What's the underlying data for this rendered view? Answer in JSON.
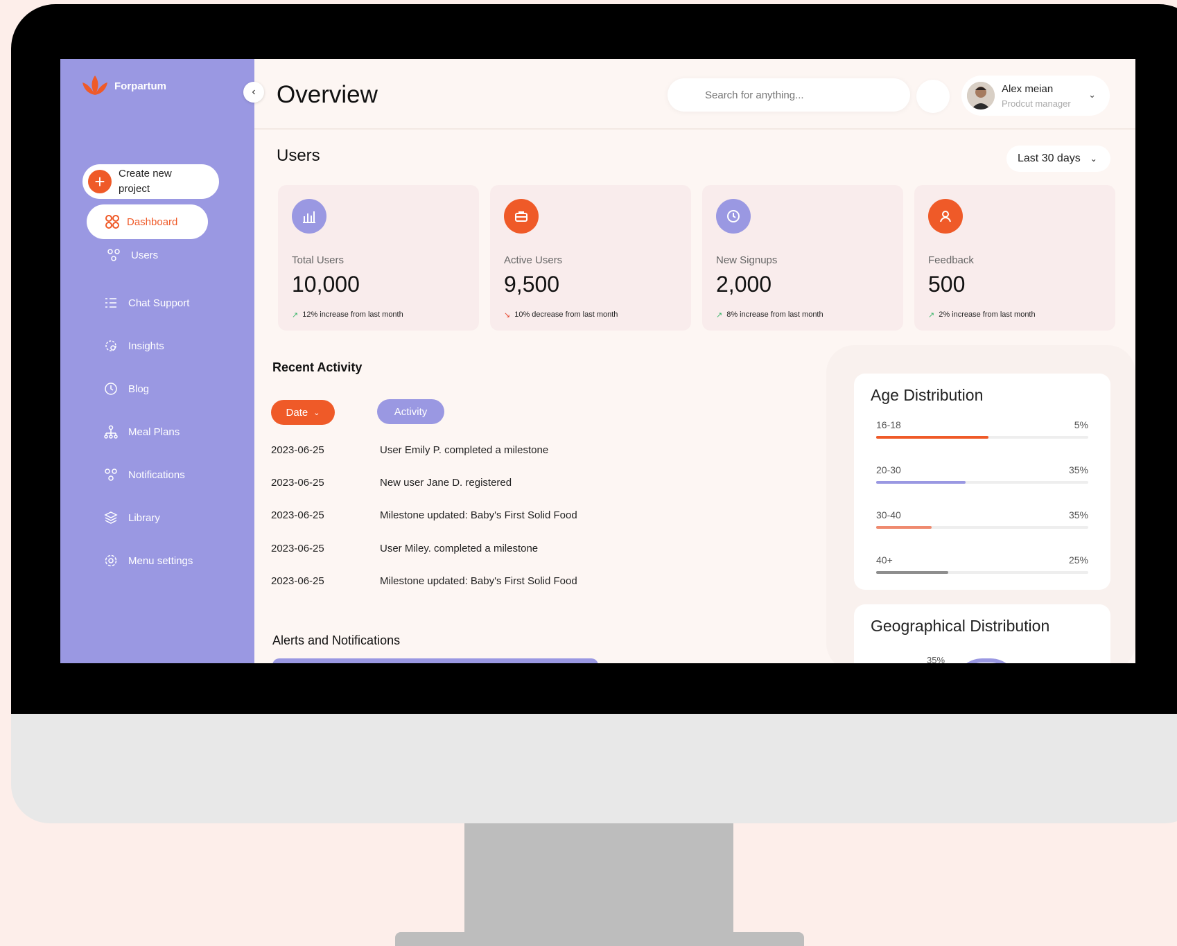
{
  "app": {
    "logo_text": "Forpartum",
    "page_title": "Overview"
  },
  "sidebar": {
    "create_label": "Create new project",
    "dashboard_label": "Dashboard",
    "items": [
      {
        "label": "Users",
        "icon": "users-icon"
      },
      {
        "label": "Chat Support",
        "icon": "list-icon"
      },
      {
        "label": "Insights",
        "icon": "insights-icon"
      },
      {
        "label": "Blog",
        "icon": "clock-icon"
      },
      {
        "label": "Meal Plans",
        "icon": "hierarchy-icon"
      },
      {
        "label": "Notifications",
        "icon": "people-icon"
      },
      {
        "label": "Library",
        "icon": "layers-icon"
      },
      {
        "label": "Menu settings",
        "icon": "gear-icon"
      }
    ]
  },
  "header": {
    "search_placeholder": "Search for anything...",
    "user_name": "Alex meian",
    "user_role": "Prodcut manager"
  },
  "users": {
    "title": "Users",
    "range": "Last 30 days",
    "cards": [
      {
        "label": "Total Users",
        "value": "10,000",
        "trend": "12% increase from last month",
        "direction": "up",
        "icon": "bar-chart-icon",
        "color": "#9a98e2"
      },
      {
        "label": "Active Users",
        "value": "9,500",
        "trend": "10% decrease from last month",
        "direction": "down",
        "icon": "briefcase-icon",
        "color": "#ef5a28"
      },
      {
        "label": "New Signups",
        "value": "2,000",
        "trend": "8% increase from last month",
        "direction": "up",
        "icon": "clock-icon",
        "color": "#9a98e2"
      },
      {
        "label": "Feedback",
        "value": "500",
        "trend": "2% increase from last month",
        "direction": "up",
        "icon": "user-icon",
        "color": "#ef5a28"
      }
    ]
  },
  "recent_activity": {
    "title": "Recent Activity",
    "filter_date": "Date",
    "filter_activity": "Activity",
    "rows": [
      {
        "date": "2023-06-25",
        "activity": "User Emily P. completed a milestone"
      },
      {
        "date": "2023-06-25",
        "activity": "New user Jane D. registered"
      },
      {
        "date": "2023-06-25",
        "activity": "Milestone updated: Baby's First Solid Food"
      },
      {
        "date": "2023-06-25",
        "activity": "User Miley. completed a milestone"
      },
      {
        "date": "2023-06-25",
        "activity": "Milestone updated: Baby's First Solid Food"
      }
    ]
  },
  "alerts": {
    "title": "Alerts and Notifications"
  },
  "age_distribution": {
    "title": "Age Distribution",
    "rows": [
      {
        "label": "16-18",
        "percent": "5%",
        "fill": 0.53,
        "color": "#ef5a28"
      },
      {
        "label": "20-30",
        "percent": "35%",
        "fill": 0.42,
        "color": "#9a98e2"
      },
      {
        "label": "30-40",
        "percent": "35%",
        "fill": 0.26,
        "color": "#ef8a6f"
      },
      {
        "label": "40+",
        "percent": "25%",
        "fill": 0.34,
        "color": "#8e8e8e"
      }
    ]
  },
  "geo_distribution": {
    "title": "Geographical Distribution",
    "first_label": "35%"
  }
}
